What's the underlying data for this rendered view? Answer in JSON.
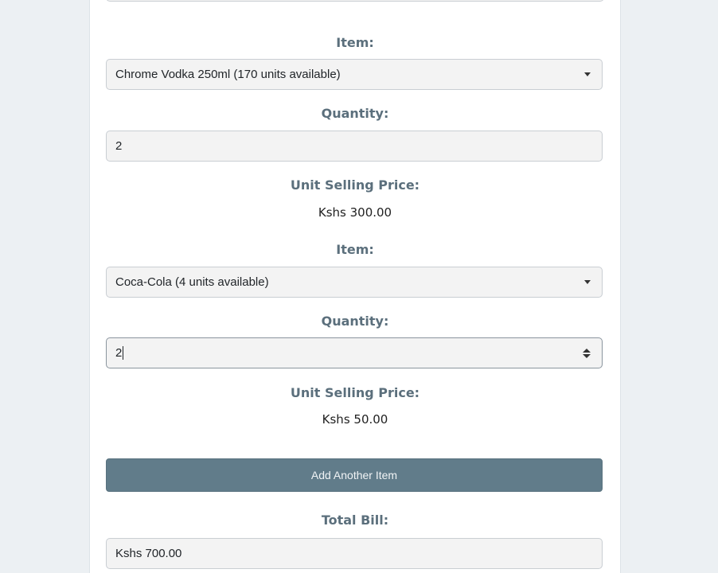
{
  "form": {
    "items": [
      {
        "item_label": "Item:",
        "item_value": "Chrome Vodka 250ml (170 units available)",
        "quantity_label": "Quantity:",
        "quantity_value": "2",
        "price_label": "Unit Selling Price:",
        "price_value": "Kshs 300.00"
      },
      {
        "item_label": "Item:",
        "item_value": "Coca-Cola (4 units available)",
        "quantity_label": "Quantity:",
        "quantity_value": "2",
        "price_label": "Unit Selling Price:",
        "price_value": "Kshs 50.00"
      }
    ],
    "add_item_label": "Add Another Item",
    "total_label": "Total Bill:",
    "total_value": "Kshs 700.00"
  },
  "colors": {
    "background": "#ecf0f3",
    "card": "#ffffff",
    "label": "#5b6f7c",
    "button": "#617c8a",
    "field": "#f3f3f3"
  },
  "icons": {
    "select_caret": "caret-down-icon",
    "number_spinner": "spinner-icon"
  }
}
